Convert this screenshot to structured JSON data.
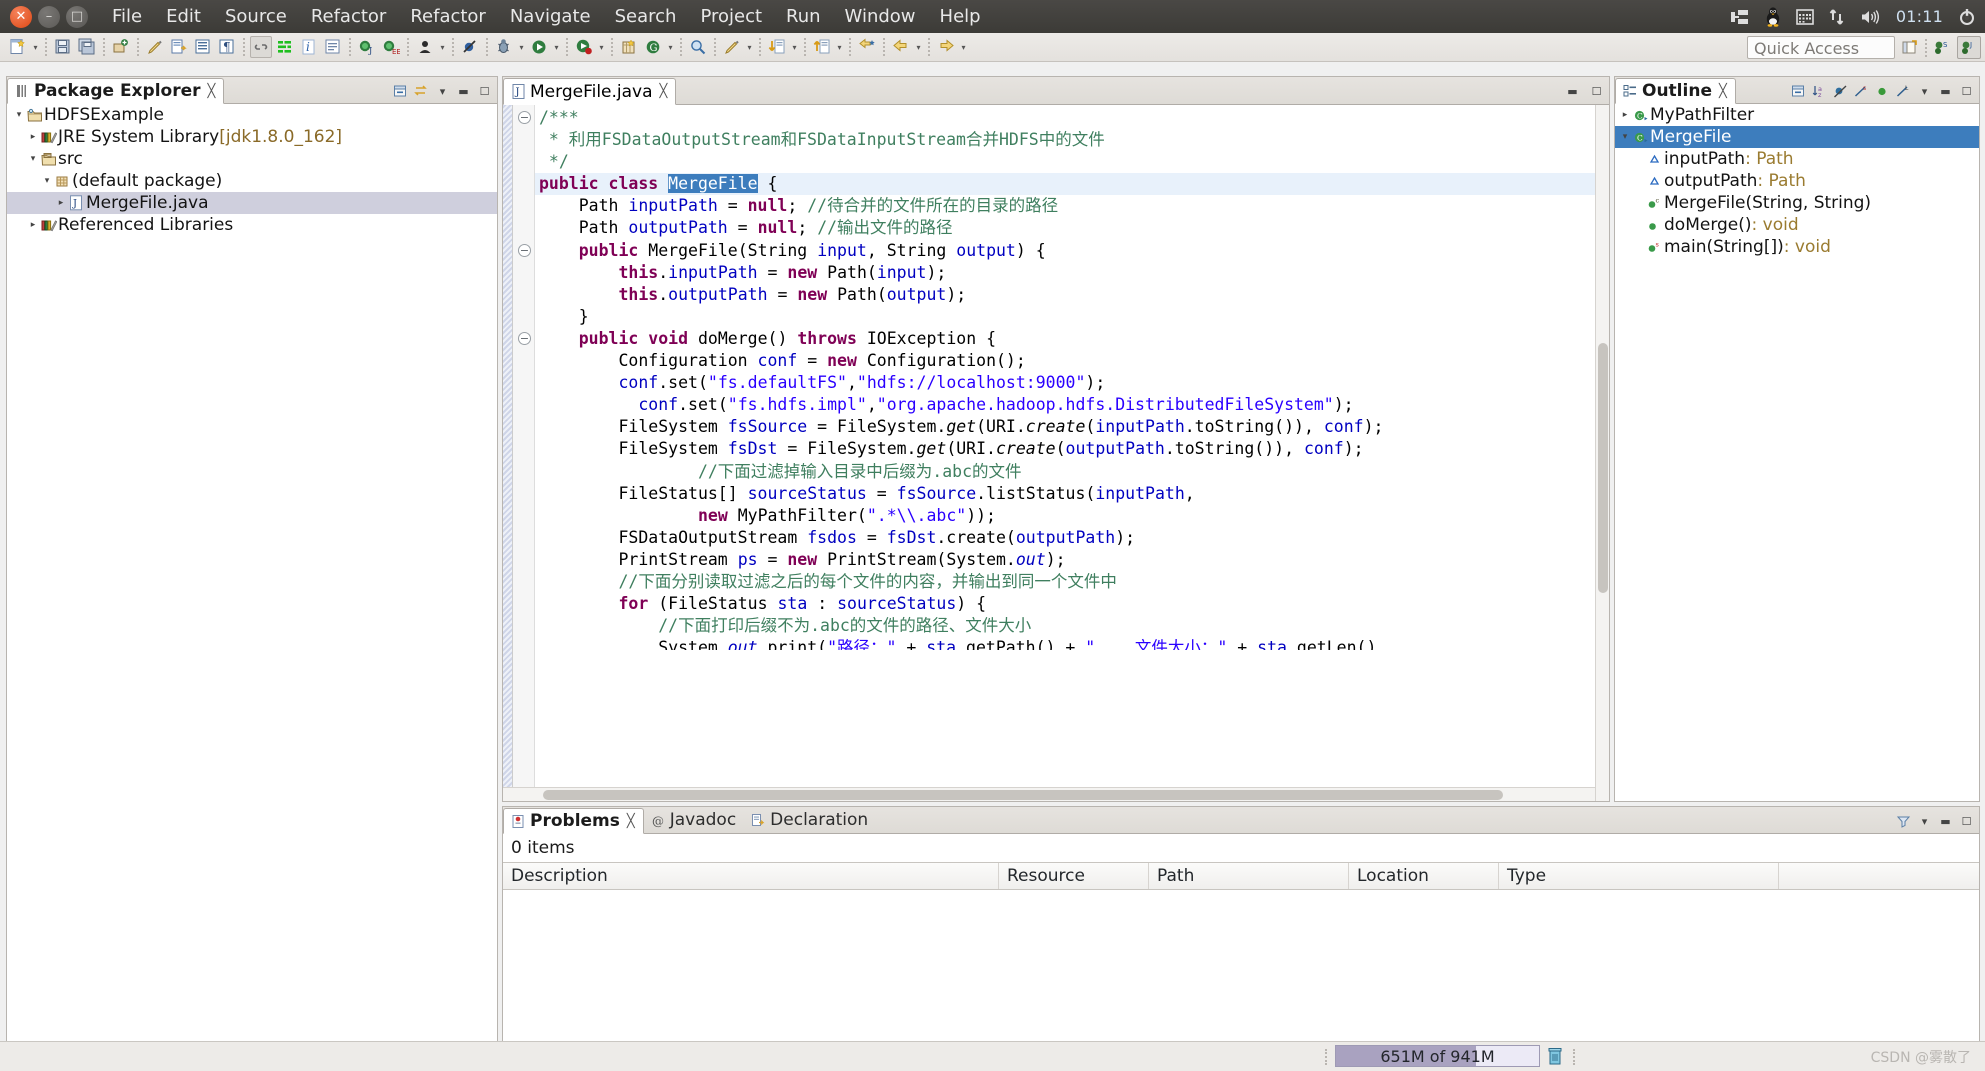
{
  "desktop": {
    "window_controls": [
      "close",
      "minimize",
      "maximize"
    ],
    "menus": [
      "File",
      "Edit",
      "Source",
      "Refactor",
      "Refactor",
      "Navigate",
      "Search",
      "Project",
      "Run",
      "Window",
      "Help"
    ],
    "tray": {
      "clock": "01:11",
      "icons": [
        "keyboard-layout-icon",
        "tux-icon",
        "calendar-icon",
        "network-icon",
        "volume-icon",
        "power-gear-icon"
      ]
    }
  },
  "toolbar": {
    "quick_access_placeholder": "Quick Access",
    "buttons": [
      {
        "name": "new-wizard-icon",
        "glyph": "🗋"
      },
      {
        "name": "new-dropdown-icon",
        "glyph": "▾"
      },
      {
        "name": "save-icon",
        "glyph": "💾"
      },
      {
        "name": "save-all-icon",
        "glyph": "🗂"
      },
      {
        "name": "new-java-package-icon",
        "glyph": "⚙"
      },
      {
        "name": "quick-fix-icon",
        "glyph": "🖌"
      },
      {
        "name": "export-icon",
        "glyph": "🗒"
      },
      {
        "name": "toggle-block-selection-icon",
        "glyph": "▤"
      },
      {
        "name": "show-whitespace-icon",
        "glyph": "¶"
      },
      {
        "name": "link-with-editor-icon",
        "glyph": "↺"
      },
      {
        "name": "toggle-mark-occurrences-icon",
        "glyph": "≣"
      },
      {
        "name": "italic-info-icon",
        "glyph": "i"
      },
      {
        "name": "open-console-icon",
        "glyph": "☰"
      },
      {
        "name": "new-java-project-icon",
        "glyph": "J"
      },
      {
        "name": "new-java-ee-project-icon",
        "glyph": "EE"
      },
      {
        "name": "open-type-icon",
        "glyph": "●"
      },
      {
        "name": "open-type-dropdown-icon",
        "glyph": "▾"
      },
      {
        "name": "skip-breakpoints-icon",
        "glyph": "⊘"
      },
      {
        "name": "debug-icon",
        "glyph": "🐞"
      },
      {
        "name": "debug-dropdown-icon",
        "glyph": "▾"
      },
      {
        "name": "run-icon",
        "glyph": "▶"
      },
      {
        "name": "run-dropdown-icon",
        "glyph": "▾"
      },
      {
        "name": "coverage-icon",
        "glyph": "▶"
      },
      {
        "name": "coverage-dropdown-icon",
        "glyph": "▾"
      },
      {
        "name": "new-ant-build-icon",
        "glyph": "⚒"
      },
      {
        "name": "external-tools-icon",
        "glyph": "G"
      },
      {
        "name": "external-tools-dropdown-icon",
        "glyph": "▾"
      },
      {
        "name": "search-icon",
        "glyph": "🔍"
      },
      {
        "name": "annotation-icon",
        "glyph": "✎"
      },
      {
        "name": "annotation-dropdown-icon",
        "glyph": "▾"
      },
      {
        "name": "previous-annotation-icon",
        "glyph": "↓"
      },
      {
        "name": "previous-annotation-dropdown-icon",
        "glyph": "▾"
      },
      {
        "name": "next-annotation-icon",
        "glyph": "↑"
      },
      {
        "name": "next-annotation-dropdown-icon",
        "glyph": "▾"
      },
      {
        "name": "last-edit-location-icon",
        "glyph": "←"
      },
      {
        "name": "back-icon",
        "glyph": "←"
      },
      {
        "name": "back-dropdown-icon",
        "glyph": "▾"
      },
      {
        "name": "forward-icon",
        "glyph": "→"
      },
      {
        "name": "forward-dropdown-icon",
        "glyph": "▾"
      }
    ],
    "perspective_buttons": [
      "open-perspective-icon",
      "java-ee-perspective-icon",
      "java-perspective-icon"
    ]
  },
  "package_explorer": {
    "tab_label": "Package Explorer",
    "toolbar_icons": [
      "collapse-all-icon",
      "link-with-editor-icon",
      "view-menu-icon",
      "minimize-icon",
      "maximize-icon"
    ],
    "tree": [
      {
        "label": "HDFSExample",
        "depth": 0,
        "twisty": "▾",
        "icon": "java-project-icon",
        "selected": false
      },
      {
        "label": "JRE System Library",
        "suffix": " [jdk1.8.0_162]",
        "depth": 1,
        "twisty": "▸",
        "icon": "library-icon",
        "selected": false
      },
      {
        "label": "src",
        "depth": 1,
        "twisty": "▾",
        "icon": "source-folder-icon",
        "selected": false
      },
      {
        "label": "(default package)",
        "depth": 2,
        "twisty": "▾",
        "icon": "package-icon",
        "selected": false
      },
      {
        "label": "MergeFile.java",
        "depth": 3,
        "twisty": "▸",
        "icon": "java-file-icon",
        "selected": true
      },
      {
        "label": "Referenced Libraries",
        "depth": 1,
        "twisty": "▸",
        "icon": "library-icon",
        "selected": false
      }
    ]
  },
  "editor": {
    "tab_label": "MergeFile.java",
    "tab_icon": "java-file-icon",
    "minimize_icon": "minimize-icon",
    "maximize_icon": "maximize-icon",
    "lines": [
      {
        "fold": true,
        "segments": [
          {
            "t": "/***",
            "c": "cm"
          }
        ]
      },
      {
        "segments": [
          {
            "t": " * 利用FSDataOutputStream和FSDataInputStream合并HDFS中的文件",
            "c": "cm"
          }
        ]
      },
      {
        "segments": [
          {
            "t": " */",
            "c": "cm"
          }
        ]
      },
      {
        "hl": true,
        "segments": [
          {
            "t": "public class ",
            "c": "kw"
          },
          {
            "t": "MergeFile",
            "c": "sel-token"
          },
          {
            "t": " {",
            "c": ""
          }
        ]
      },
      {
        "segments": [
          {
            "t": "    Path ",
            "c": ""
          },
          {
            "t": "inputPath",
            "c": "fld"
          },
          {
            "t": " = ",
            "c": ""
          },
          {
            "t": "null",
            "c": "kw"
          },
          {
            "t": "; ",
            "c": ""
          },
          {
            "t": "//待合并的文件所在的目录的路径",
            "c": "cm"
          }
        ]
      },
      {
        "segments": [
          {
            "t": "    Path ",
            "c": ""
          },
          {
            "t": "outputPath",
            "c": "fld"
          },
          {
            "t": " = ",
            "c": ""
          },
          {
            "t": "null",
            "c": "kw"
          },
          {
            "t": "; ",
            "c": ""
          },
          {
            "t": "//输出文件的路径",
            "c": "cm"
          }
        ]
      },
      {
        "fold": true,
        "segments": [
          {
            "t": "    ",
            "c": ""
          },
          {
            "t": "public ",
            "c": "kw"
          },
          {
            "t": "MergeFile(String ",
            "c": ""
          },
          {
            "t": "input",
            "c": "fld"
          },
          {
            "t": ", String ",
            "c": ""
          },
          {
            "t": "output",
            "c": "fld"
          },
          {
            "t": ") {",
            "c": ""
          }
        ]
      },
      {
        "segments": [
          {
            "t": "        ",
            "c": ""
          },
          {
            "t": "this",
            "c": "kw"
          },
          {
            "t": ".",
            "c": ""
          },
          {
            "t": "inputPath",
            "c": "fld"
          },
          {
            "t": " = ",
            "c": ""
          },
          {
            "t": "new ",
            "c": "kw"
          },
          {
            "t": "Path(",
            "c": ""
          },
          {
            "t": "input",
            "c": "fld"
          },
          {
            "t": ");",
            "c": ""
          }
        ]
      },
      {
        "segments": [
          {
            "t": "        ",
            "c": ""
          },
          {
            "t": "this",
            "c": "kw"
          },
          {
            "t": ".",
            "c": ""
          },
          {
            "t": "outputPath",
            "c": "fld"
          },
          {
            "t": " = ",
            "c": ""
          },
          {
            "t": "new ",
            "c": "kw"
          },
          {
            "t": "Path(",
            "c": ""
          },
          {
            "t": "output",
            "c": "fld"
          },
          {
            "t": ");",
            "c": ""
          }
        ]
      },
      {
        "segments": [
          {
            "t": "    }",
            "c": ""
          }
        ]
      },
      {
        "fold": true,
        "segments": [
          {
            "t": "    ",
            "c": ""
          },
          {
            "t": "public void ",
            "c": "kw"
          },
          {
            "t": "doMerge() ",
            "c": ""
          },
          {
            "t": "throws ",
            "c": "kw"
          },
          {
            "t": "IOException {",
            "c": ""
          }
        ]
      },
      {
        "segments": [
          {
            "t": "        Configuration ",
            "c": ""
          },
          {
            "t": "conf",
            "c": "fld"
          },
          {
            "t": " = ",
            "c": ""
          },
          {
            "t": "new ",
            "c": "kw"
          },
          {
            "t": "Configuration();",
            "c": ""
          }
        ]
      },
      {
        "segments": [
          {
            "t": "        ",
            "c": ""
          },
          {
            "t": "conf",
            "c": "fld"
          },
          {
            "t": ".set(",
            "c": ""
          },
          {
            "t": "\"fs.defaultFS\"",
            "c": "str"
          },
          {
            "t": ",",
            "c": ""
          },
          {
            "t": "\"hdfs://localhost:9000\"",
            "c": "str"
          },
          {
            "t": ");",
            "c": ""
          }
        ]
      },
      {
        "segments": [
          {
            "t": "          ",
            "c": ""
          },
          {
            "t": "conf",
            "c": "fld"
          },
          {
            "t": ".set(",
            "c": ""
          },
          {
            "t": "\"fs.hdfs.impl\"",
            "c": "str"
          },
          {
            "t": ",",
            "c": ""
          },
          {
            "t": "\"org.apache.hadoop.hdfs.DistributedFileSystem\"",
            "c": "str"
          },
          {
            "t": ");",
            "c": ""
          }
        ]
      },
      {
        "segments": [
          {
            "t": "        FileSystem ",
            "c": ""
          },
          {
            "t": "fsSource",
            "c": "fld"
          },
          {
            "t": " = FileSystem.",
            "c": ""
          },
          {
            "t": "get",
            "c": "stat"
          },
          {
            "t": "(URI.",
            "c": ""
          },
          {
            "t": "create",
            "c": "stat"
          },
          {
            "t": "(",
            "c": ""
          },
          {
            "t": "inputPath",
            "c": "fld"
          },
          {
            "t": ".toString()), ",
            "c": ""
          },
          {
            "t": "conf",
            "c": "fld"
          },
          {
            "t": ");",
            "c": ""
          }
        ]
      },
      {
        "segments": [
          {
            "t": "        FileSystem ",
            "c": ""
          },
          {
            "t": "fsDst",
            "c": "fld"
          },
          {
            "t": " = FileSystem.",
            "c": ""
          },
          {
            "t": "get",
            "c": "stat"
          },
          {
            "t": "(URI.",
            "c": ""
          },
          {
            "t": "create",
            "c": "stat"
          },
          {
            "t": "(",
            "c": ""
          },
          {
            "t": "outputPath",
            "c": "fld"
          },
          {
            "t": ".toString()), ",
            "c": ""
          },
          {
            "t": "conf",
            "c": "fld"
          },
          {
            "t": ");",
            "c": ""
          }
        ]
      },
      {
        "segments": [
          {
            "t": "                //下面过滤掉输入目录中后缀为.abc的文件",
            "c": "cm"
          }
        ]
      },
      {
        "segments": [
          {
            "t": "        FileStatus[] ",
            "c": ""
          },
          {
            "t": "sourceStatus",
            "c": "fld"
          },
          {
            "t": " = ",
            "c": ""
          },
          {
            "t": "fsSource",
            "c": "fld"
          },
          {
            "t": ".listStatus(",
            "c": ""
          },
          {
            "t": "inputPath",
            "c": "fld"
          },
          {
            "t": ",",
            "c": ""
          }
        ]
      },
      {
        "segments": [
          {
            "t": "                ",
            "c": ""
          },
          {
            "t": "new ",
            "c": "kw"
          },
          {
            "t": "MyPathFilter(",
            "c": ""
          },
          {
            "t": "\".*\\\\.abc\"",
            "c": "str"
          },
          {
            "t": "));",
            "c": ""
          }
        ]
      },
      {
        "segments": [
          {
            "t": "        FSDataOutputStream ",
            "c": ""
          },
          {
            "t": "fsdos",
            "c": "fld"
          },
          {
            "t": " = ",
            "c": ""
          },
          {
            "t": "fsDst",
            "c": "fld"
          },
          {
            "t": ".create(",
            "c": ""
          },
          {
            "t": "outputPath",
            "c": "fld"
          },
          {
            "t": ");",
            "c": ""
          }
        ]
      },
      {
        "segments": [
          {
            "t": "        PrintStream ",
            "c": ""
          },
          {
            "t": "ps",
            "c": "fld"
          },
          {
            "t": " = ",
            "c": ""
          },
          {
            "t": "new ",
            "c": "kw"
          },
          {
            "t": "PrintStream(System.",
            "c": ""
          },
          {
            "t": "out",
            "c": "stat fld"
          },
          {
            "t": ");",
            "c": ""
          }
        ]
      },
      {
        "segments": [
          {
            "t": "        //下面分别读取过滤之后的每个文件的内容，并输出到同一个文件中",
            "c": "cm"
          }
        ]
      },
      {
        "segments": [
          {
            "t": "        ",
            "c": ""
          },
          {
            "t": "for ",
            "c": "kw"
          },
          {
            "t": "(FileStatus ",
            "c": ""
          },
          {
            "t": "sta",
            "c": "fld"
          },
          {
            "t": " : ",
            "c": ""
          },
          {
            "t": "sourceStatus",
            "c": "fld"
          },
          {
            "t": ") {",
            "c": ""
          }
        ]
      },
      {
        "segments": [
          {
            "t": "            //下面打印后缀不为.abc的文件的路径、文件大小",
            "c": "cm"
          }
        ]
      },
      {
        "clipped": true,
        "segments": [
          {
            "t": "            System.",
            "c": ""
          },
          {
            "t": "out",
            "c": "stat fld"
          },
          {
            "t": ".print(",
            "c": ""
          },
          {
            "t": "\"路径：\"",
            "c": "str"
          },
          {
            "t": " + ",
            "c": ""
          },
          {
            "t": "sta",
            "c": "fld"
          },
          {
            "t": ".getPath() + ",
            "c": ""
          },
          {
            "t": "\"    文件大小：\"",
            "c": "str"
          },
          {
            "t": " + ",
            "c": ""
          },
          {
            "t": "sta",
            "c": "fld"
          },
          {
            "t": ".getLen()",
            "c": ""
          }
        ]
      }
    ]
  },
  "outline": {
    "tab_label": "Outline",
    "toolbar_icons": [
      "collapse-all-icon",
      "sort-icon",
      "hide-fields-icon",
      "hide-static-icon",
      "hide-non-public-icon",
      "hide-local-types-icon",
      "view-menu-icon",
      "minimize-icon",
      "maximize-icon"
    ],
    "items": [
      {
        "label": "MyPathFilter",
        "twisty": "▸",
        "icon": "class-icon",
        "depth": 0,
        "selected": false
      },
      {
        "label": "MergeFile",
        "twisty": "▾",
        "icon": "class-icon",
        "depth": 0,
        "selected": true
      },
      {
        "label": "inputPath",
        "type": " : Path",
        "icon": "field-default-icon",
        "depth": 1,
        "selected": false
      },
      {
        "label": "outputPath",
        "type": " : Path",
        "icon": "field-default-icon",
        "depth": 1,
        "selected": false
      },
      {
        "label": "MergeFile(String, String)",
        "type": "",
        "icon": "constructor-icon",
        "depth": 1,
        "selected": false
      },
      {
        "label": "doMerge()",
        "type": " : void",
        "icon": "method-icon",
        "depth": 1,
        "selected": false
      },
      {
        "label": "main(String[])",
        "type": " : void",
        "icon": "static-method-icon",
        "depth": 1,
        "selected": false
      }
    ]
  },
  "problems": {
    "tabs": [
      {
        "label": "Problems",
        "icon": "problems-icon",
        "active": true,
        "closeable": true
      },
      {
        "label": "Javadoc",
        "icon": "javadoc-icon",
        "active": false,
        "closeable": false
      },
      {
        "label": "Declaration",
        "icon": "declaration-icon",
        "active": false,
        "closeable": false
      }
    ],
    "toolbar_icons": [
      "filters-icon",
      "view-menu-icon",
      "minimize-icon",
      "maximize-icon"
    ],
    "items_count": "0 items",
    "columns": [
      "Description",
      "Resource",
      "Path",
      "Location",
      "Type"
    ],
    "rows": []
  },
  "statusbar": {
    "heap_text": "651M of 941M",
    "heap_percent": 69,
    "trash_icon": "trash-icon",
    "watermark": "CSDN @雾散了"
  },
  "colors": {
    "selection_blue": "#3d7dbd",
    "tree_selection": "#cfcfdd",
    "keyword": "#7f0055",
    "comment": "#3f7f5f",
    "string": "#2a00ff",
    "field": "#0000c0",
    "line_highlight": "#e8f1fb",
    "menubar_bg": "#3f3d3a",
    "toolbar_bg": "#e8e5e1",
    "heap_fill": "#a9a2c0"
  }
}
